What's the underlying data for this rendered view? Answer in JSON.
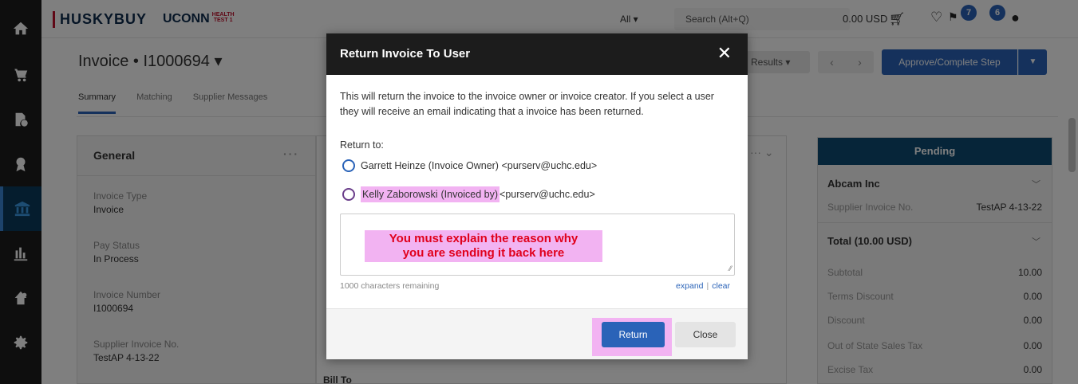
{
  "rail": {
    "items": [
      "home-icon",
      "cart-icon",
      "document-clock-icon",
      "award-icon",
      "bank-icon",
      "chart-icon",
      "settings-user-icon",
      "gear-icon"
    ],
    "active_index": 4
  },
  "header": {
    "brand": "HUSKYBUY",
    "brand2": "UCONN",
    "brand2_sub1": "HEALTH",
    "brand2_sub2": "TEST 1",
    "search_scope": "All ▾",
    "search_placeholder": "Search (Alt+Q)",
    "cart_amount": "0.00 USD",
    "favorites_badge": "7",
    "user_badge": "6"
  },
  "page": {
    "title": "Invoice  •  I1000694 ▾",
    "tabs": [
      "Summary",
      "Matching",
      "Supplier Messages"
    ],
    "results_label": "Results ▾",
    "prev": "‹",
    "next": "›",
    "approve_label": "Approve/Complete Step",
    "approve_dropdown": "▼"
  },
  "general": {
    "title": "General",
    "dots": "···",
    "fields": [
      {
        "label": "Invoice Type",
        "value": "Invoice"
      },
      {
        "label": "Pay Status",
        "value": "In Process"
      },
      {
        "label": "Invoice Number",
        "value": "I1000694"
      },
      {
        "label": "Supplier Invoice No.",
        "value": "TestAP 4-13-22"
      }
    ]
  },
  "middle": {
    "dots": "··· ⌄",
    "bill_to": "Bill To"
  },
  "right_panel": {
    "status": "Pending",
    "supplier": "Abcam Inc",
    "supplier_invoice_label": "Supplier Invoice No.",
    "supplier_invoice_value": "TestAP 4-13-22",
    "total_title": "Total (10.00 USD)",
    "lines": [
      {
        "label": "Subtotal",
        "value": "10.00"
      },
      {
        "label": "Terms Discount",
        "value": "0.00"
      },
      {
        "label": "Discount",
        "value": "0.00"
      },
      {
        "label": "Out of State Sales Tax",
        "value": "0.00"
      },
      {
        "label": "Excise Tax",
        "value": "0.00"
      }
    ]
  },
  "modal": {
    "title": "Return Invoice To User",
    "close": "✕",
    "description": "This will return the invoice to the invoice owner or invoice creator. If you select a user they will receive an email indicating that a invoice has been returned.",
    "return_to_label": "Return to:",
    "option1": "Garrett Heinze (Invoice Owner) <purserv@uchc.edu>",
    "option2_name": "Kelly Zaborowski ",
    "option2_role": "(Invoiced by)",
    "option2_email": " <purserv@uchc.edu>",
    "note_line1": "You must explain the reason why",
    "note_line2": "you are sending it back here",
    "chars_remaining": "1000 characters remaining",
    "expand": "expand",
    "clear": "clear",
    "return_button": "Return",
    "close_button": "Close"
  }
}
